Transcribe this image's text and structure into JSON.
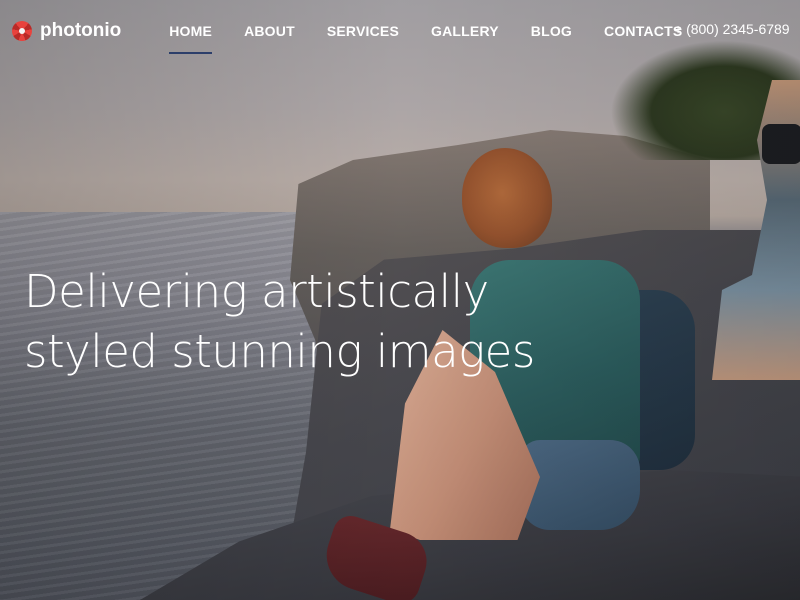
{
  "brand": {
    "name": "photonio",
    "icon": "aperture-icon",
    "accent_color": "#e8423d"
  },
  "nav": {
    "items": [
      {
        "label": "HOME",
        "active": true
      },
      {
        "label": "ABOUT",
        "active": false
      },
      {
        "label": "SERVICES",
        "active": false
      },
      {
        "label": "GALLERY",
        "active": false
      },
      {
        "label": "BLOG",
        "active": false
      },
      {
        "label": "CONTACTS",
        "active": false
      }
    ],
    "active_underline_color": "#2c3e6a"
  },
  "contact": {
    "phone": "+ (800) 2345-6789"
  },
  "hero": {
    "headline_line1": "Delivering artistically",
    "headline_line2": "styled stunning images"
  }
}
